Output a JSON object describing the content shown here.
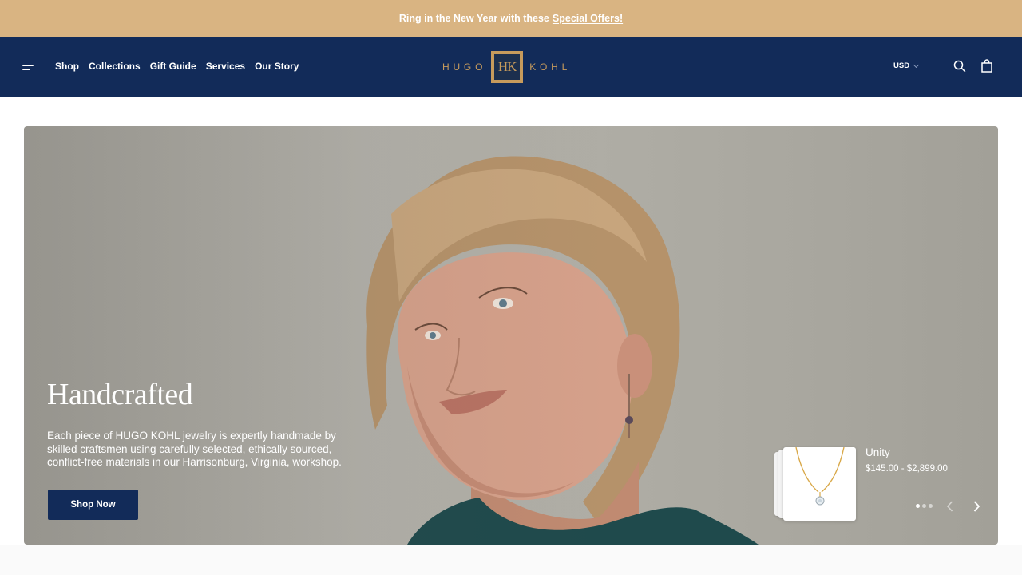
{
  "announcement": {
    "text": "Ring in the New Year with these",
    "link": "Special Offers!"
  },
  "header": {
    "nav": [
      "Shop",
      "Collections",
      "Gift Guide",
      "Services",
      "Our Story"
    ],
    "logo": {
      "left": "HUGO",
      "mark": "HK",
      "right": "KOHL"
    },
    "currency": "USD",
    "icons": [
      "menu-icon",
      "search-icon",
      "bag-icon",
      "chevron-down-icon"
    ]
  },
  "hero": {
    "title": "Handcrafted",
    "text": "Each piece of HUGO KOHL jewelry is expertly handmade by skilled craftsmen using carefully selected, ethically sourced, conflict-free materials in our Harrisonburg, Virginia, workshop.",
    "cta": "Shop Now",
    "product": {
      "name": "Unity",
      "price": "$145.00 - $2,899.00"
    },
    "slides": {
      "count": 3,
      "active": 1
    }
  },
  "colors": {
    "announcement_bg": "#d9b482",
    "header_bg": "#122b59",
    "gold": "#c79b5c",
    "button_bg": "#122b59"
  }
}
